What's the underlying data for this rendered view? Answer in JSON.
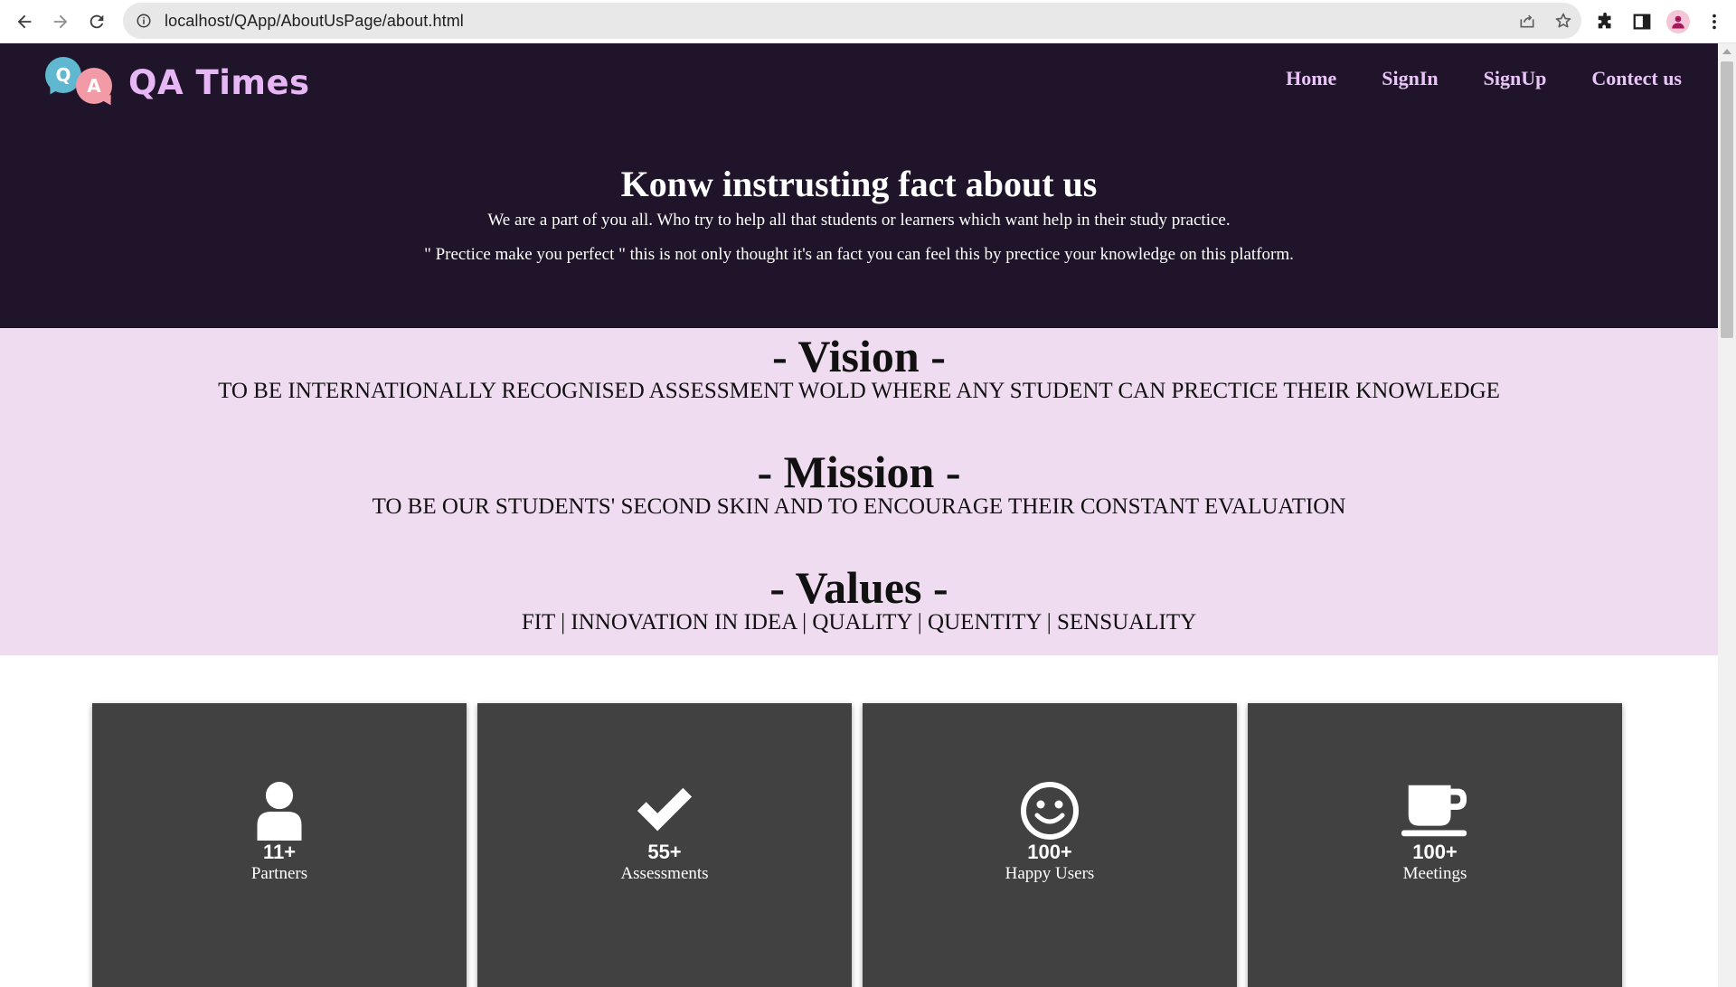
{
  "browser": {
    "url": "localhost/QApp/AboutUsPage/about.html"
  },
  "header": {
    "logo_q": "Q",
    "logo_a": "A",
    "brand": "QA Times",
    "nav": [
      {
        "label": "Home"
      },
      {
        "label": "SignIn"
      },
      {
        "label": "SignUp"
      },
      {
        "label": "Contect us"
      }
    ]
  },
  "hero": {
    "title": "Konw instrusting fact about us",
    "line1": "We are a part of you all. Who try to help all that students or learners which want help in their study practice.",
    "line2": "\" Prectice make you perfect \" this is not only thought it's an fact you can feel this by prectice your knowledge on this platform."
  },
  "sections": {
    "vision": {
      "heading": "- Vision -",
      "text": "TO BE INTERNATIONALLY RECOGNISED ASSESSMENT WOLD WHERE ANY STUDENT CAN PRECTICE THEIR KNOWLEDGE"
    },
    "mission": {
      "heading": "- Mission -",
      "text": "TO BE OUR STUDENTS' SECOND SKIN AND TO ENCOURAGE THEIR CONSTANT EVALUATION"
    },
    "values": {
      "heading": "- Values -",
      "text": "FIT | INNOVATION IN IDEA | QUALITY | QUENTITY | SENSUALITY"
    }
  },
  "stats": [
    {
      "icon": "user-icon",
      "value": "11+",
      "label": "Partners"
    },
    {
      "icon": "check-icon",
      "value": "55+",
      "label": "Assessments"
    },
    {
      "icon": "smile-icon",
      "value": "100+",
      "label": "Happy Users"
    },
    {
      "icon": "coffee-icon",
      "value": "100+",
      "label": "Meetings"
    }
  ],
  "colors": {
    "hero_bg": "#1f1429",
    "brand": "#e6b6f5",
    "section_bg": "#efdcf0",
    "card_bg": "#414141"
  }
}
